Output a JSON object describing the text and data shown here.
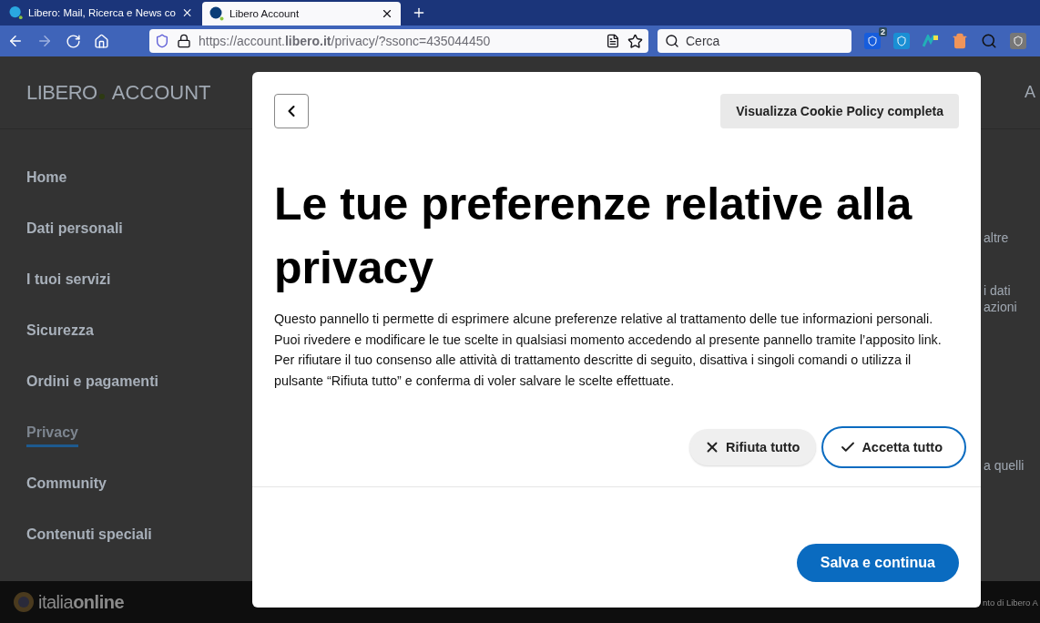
{
  "browser": {
    "tabs": [
      {
        "title": "Libero: Mail, Ricerca e News co",
        "selected": false
      },
      {
        "title": "Libero Account",
        "selected": true
      }
    ],
    "url": "https://account.**libero.it**/privacy/?ssonc=435044450",
    "search": {
      "placeholder": "Cerca"
    },
    "extension_badge": "2"
  },
  "page": {
    "logo": {
      "brand": "LIBERO",
      "product": "ACCOUNT"
    },
    "header_right": "A",
    "sidebar": [
      {
        "label": "Home",
        "selected": false
      },
      {
        "label": "Dati personali",
        "selected": false
      },
      {
        "label": "I tuoi servizi",
        "selected": false
      },
      {
        "label": "Sicurezza",
        "selected": false
      },
      {
        "label": "Ordini e pagamenti",
        "selected": false
      },
      {
        "label": "Privacy",
        "selected": true
      },
      {
        "label": "Community",
        "selected": false
      },
      {
        "label": "Contenuti speciali",
        "selected": false
      }
    ],
    "right_fragments": [
      "altre",
      "i dati\nazioni",
      "a quelli"
    ],
    "footer": {
      "brand_a": "italia",
      "brand_b": "online",
      "right_text": "nto di Libero A"
    }
  },
  "dialog": {
    "policy_button": "Visualizza Cookie Policy completa",
    "title": "Le tue preferenze relative alla privacy",
    "body": "Questo pannello ti permette di esprimere alcune preferenze relative al trattamento delle tue informazioni personali. Puoi rivedere e modificare le tue scelte in qualsiasi momento accedendo al presente pannello tramite l’apposito link. Per rifiutare il tuo consenso alle attività di trattamento descritte di seguito, disattiva i singoli comandi o utilizza il pulsante “Rifiuta tutto” e conferma di voler salvare le scelte effettuate.",
    "reject_button": "Rifiuta tutto",
    "accept_button": "Accetta tutto",
    "save_button": "Salva e continua"
  }
}
